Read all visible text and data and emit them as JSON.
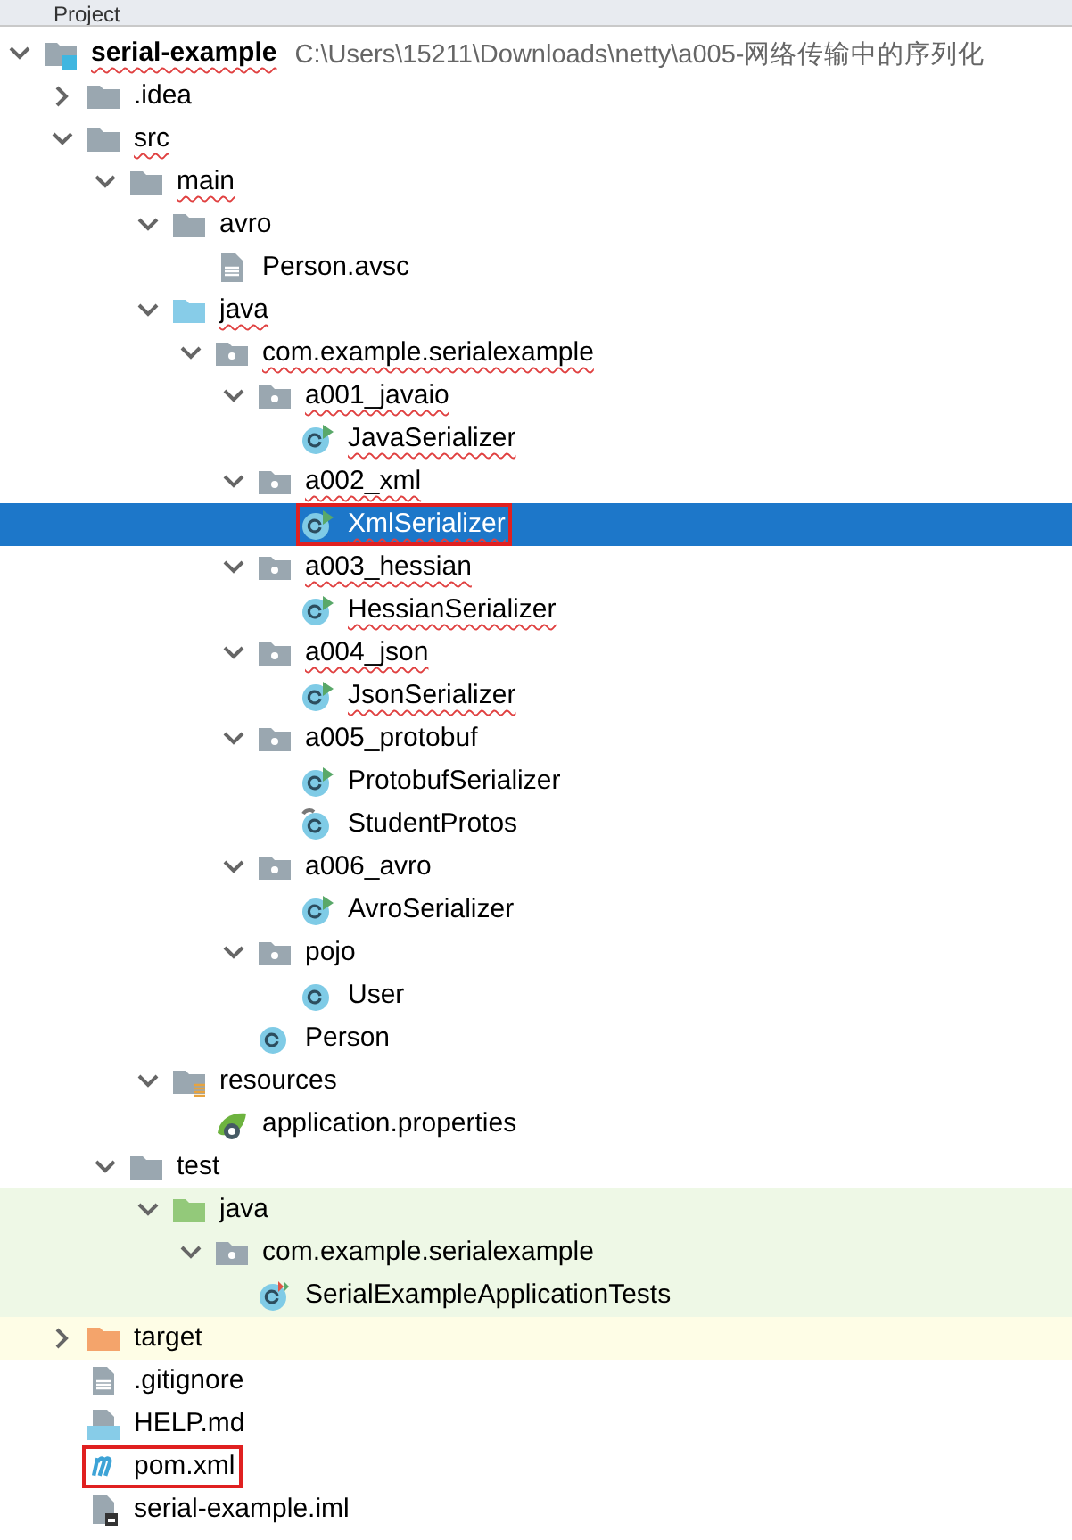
{
  "panel": {
    "title": "Project"
  },
  "tree": [
    {
      "label": "serial-example",
      "path": "C:\\Users\\15211\\Downloads\\netty\\a005-网络传输中的序列化",
      "kind": "module",
      "expanded": true,
      "selected": false,
      "typo": true,
      "children": [
        {
          "label": ".idea",
          "kind": "folder",
          "expanded": false,
          "selected": false,
          "typo": false
        },
        {
          "label": "src",
          "kind": "folder",
          "expanded": true,
          "selected": false,
          "typo": true,
          "children": [
            {
              "label": "main",
              "kind": "folder",
              "expanded": true,
              "selected": false,
              "typo": true,
              "children": [
                {
                  "label": "avro",
                  "kind": "folder",
                  "expanded": true,
                  "selected": false,
                  "typo": false,
                  "children": [
                    {
                      "label": "Person.avsc",
                      "kind": "file",
                      "selected": false,
                      "typo": false
                    }
                  ]
                },
                {
                  "label": "java",
                  "kind": "source",
                  "expanded": true,
                  "selected": false,
                  "typo": true,
                  "children": [
                    {
                      "label": "com.example.serialexample",
                      "kind": "package",
                      "expanded": true,
                      "selected": false,
                      "typo": true,
                      "children": [
                        {
                          "label": "a001_javaio",
                          "kind": "package",
                          "expanded": true,
                          "selected": false,
                          "typo": true,
                          "children": [
                            {
                              "label": "JavaSerializer",
                              "kind": "runnable-class",
                              "selected": false,
                              "typo": true
                            }
                          ]
                        },
                        {
                          "label": "a002_xml",
                          "kind": "package",
                          "expanded": true,
                          "selected": false,
                          "typo": true,
                          "children": [
                            {
                              "label": "XmlSerializer",
                              "kind": "runnable-class",
                              "selected": true,
                              "typo": true,
                              "annotated": true
                            }
                          ]
                        },
                        {
                          "label": "a003_hessian",
                          "kind": "package",
                          "expanded": true,
                          "selected": false,
                          "typo": true,
                          "children": [
                            {
                              "label": "HessianSerializer",
                              "kind": "runnable-class",
                              "selected": false,
                              "typo": true
                            }
                          ]
                        },
                        {
                          "label": "a004_json",
                          "kind": "package",
                          "expanded": true,
                          "selected": false,
                          "typo": true,
                          "children": [
                            {
                              "label": "JsonSerializer",
                              "kind": "runnable-class",
                              "selected": false,
                              "typo": true
                            }
                          ]
                        },
                        {
                          "label": "a005_protobuf",
                          "kind": "package",
                          "expanded": true,
                          "selected": false,
                          "typo": false,
                          "children": [
                            {
                              "label": "ProtobufSerializer",
                              "kind": "runnable-class",
                              "selected": false,
                              "typo": false
                            },
                            {
                              "label": "StudentProtos",
                              "kind": "generated-class",
                              "selected": false,
                              "typo": false
                            }
                          ]
                        },
                        {
                          "label": "a006_avro",
                          "kind": "package",
                          "expanded": true,
                          "selected": false,
                          "typo": false,
                          "children": [
                            {
                              "label": "AvroSerializer",
                              "kind": "runnable-class",
                              "selected": false,
                              "typo": false
                            }
                          ]
                        },
                        {
                          "label": "pojo",
                          "kind": "package",
                          "expanded": true,
                          "selected": false,
                          "typo": false,
                          "children": [
                            {
                              "label": "User",
                              "kind": "class",
                              "selected": false,
                              "typo": false
                            }
                          ]
                        },
                        {
                          "label": "Person",
                          "kind": "class",
                          "selected": false,
                          "typo": false
                        }
                      ]
                    }
                  ]
                },
                {
                  "label": "resources",
                  "kind": "resources",
                  "expanded": true,
                  "selected": false,
                  "typo": false,
                  "children": [
                    {
                      "label": "application.properties",
                      "kind": "spring",
                      "selected": false,
                      "typo": false
                    }
                  ]
                }
              ]
            },
            {
              "label": "test",
              "kind": "folder",
              "expanded": true,
              "selected": false,
              "typo": false,
              "children": [
                {
                  "label": "java",
                  "kind": "test-source",
                  "expanded": true,
                  "selected": false,
                  "typo": false,
                  "color": "#eef8e6",
                  "children": [
                    {
                      "label": "com.example.serialexample",
                      "kind": "package",
                      "expanded": true,
                      "selected": false,
                      "typo": false,
                      "color": "#eef8e6",
                      "children": [
                        {
                          "label": "SerialExampleApplicationTests",
                          "kind": "test-class",
                          "selected": false,
                          "typo": false,
                          "color": "#eef8e6"
                        }
                      ]
                    }
                  ]
                }
              ]
            }
          ]
        },
        {
          "label": "target",
          "kind": "excluded",
          "expanded": false,
          "selected": false,
          "typo": false,
          "color": "#fefde6"
        },
        {
          "label": ".gitignore",
          "kind": "file",
          "selected": false,
          "typo": false
        },
        {
          "label": "HELP.md",
          "kind": "markdown",
          "selected": false,
          "typo": false
        },
        {
          "label": "pom.xml",
          "kind": "maven",
          "selected": false,
          "typo": false,
          "annotated": true
        },
        {
          "label": "serial-example.iml",
          "kind": "iml",
          "selected": false,
          "typo": false
        }
      ]
    }
  ]
}
